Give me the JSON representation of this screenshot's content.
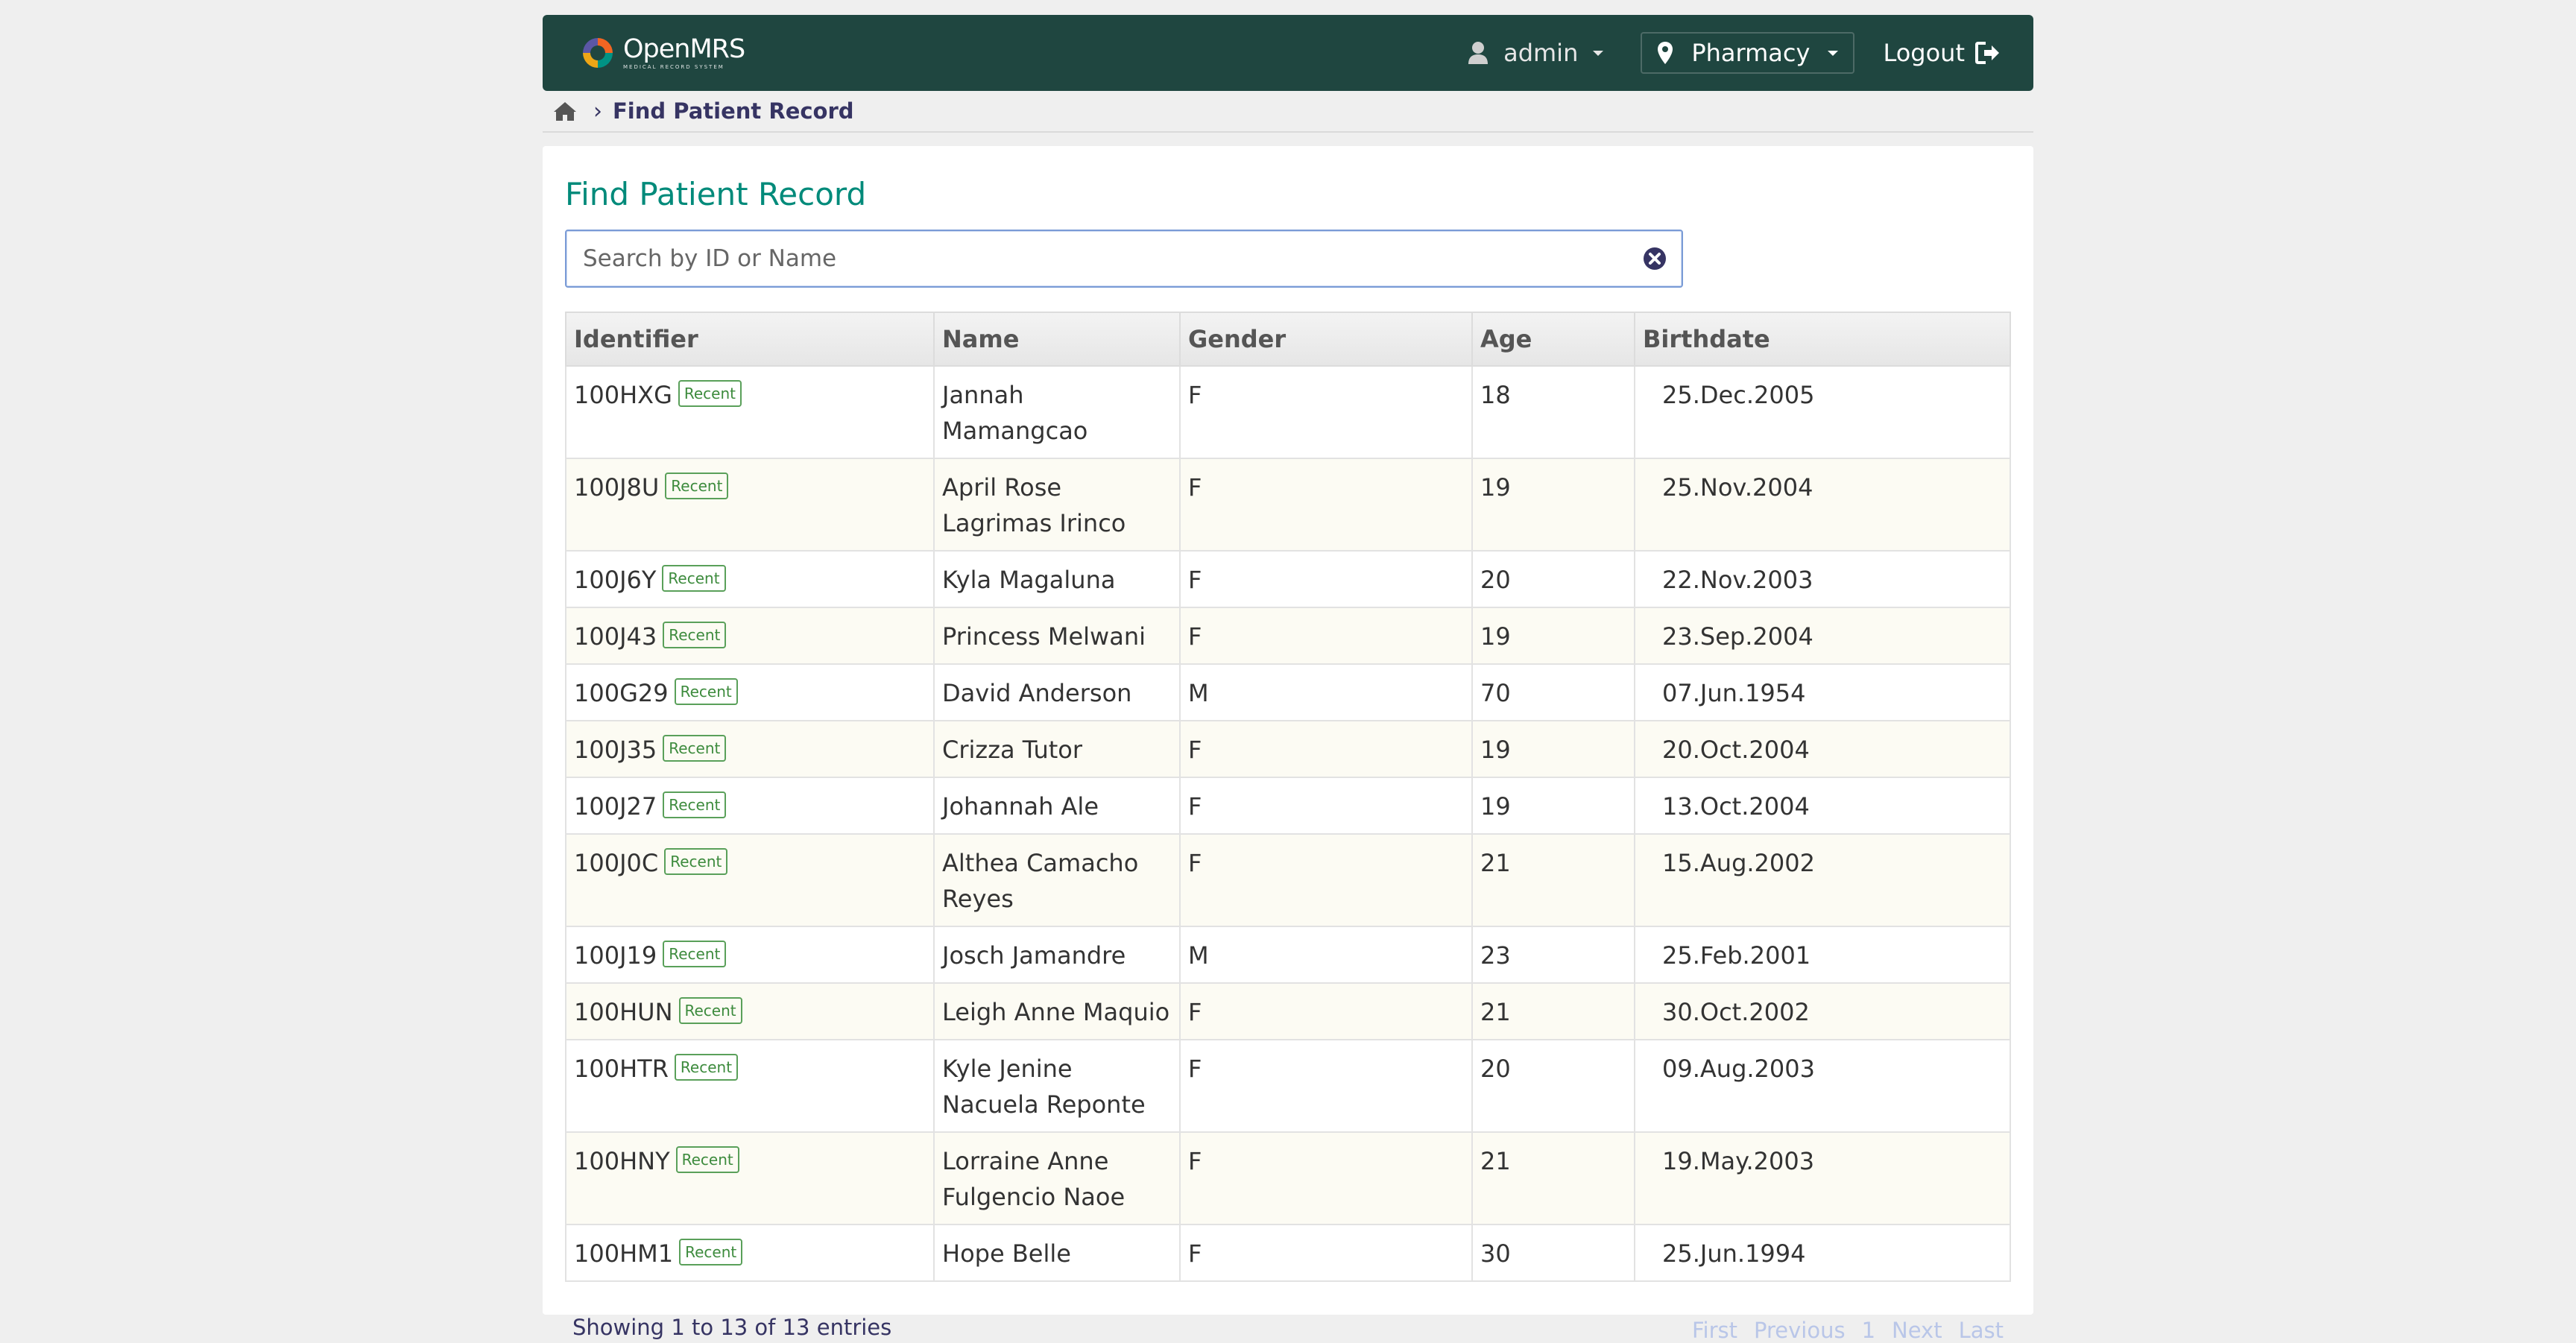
{
  "brand": {
    "name": "OpenMRS",
    "sub": "MEDICAL RECORD SYSTEM"
  },
  "header": {
    "user": "admin",
    "location": "Pharmacy",
    "logout": "Logout"
  },
  "breadcrumb": {
    "current": "Find Patient Record"
  },
  "page": {
    "title": "Find Patient Record"
  },
  "search": {
    "placeholder": "Search by ID or Name"
  },
  "table": {
    "columns": [
      "Identifier",
      "Name",
      "Gender",
      "Age",
      "Birthdate"
    ],
    "badge": "Recent",
    "rows": [
      {
        "id": "100HXG",
        "name": "Jannah Mamangcao",
        "gender": "F",
        "age": "18",
        "birthdate": "25.Dec.2005"
      },
      {
        "id": "100J8U",
        "name": "April Rose Lagrimas Irinco",
        "gender": "F",
        "age": "19",
        "birthdate": "25.Nov.2004"
      },
      {
        "id": "100J6Y",
        "name": "Kyla Magaluna",
        "gender": "F",
        "age": "20",
        "birthdate": "22.Nov.2003"
      },
      {
        "id": "100J43",
        "name": "Princess Melwani",
        "gender": "F",
        "age": "19",
        "birthdate": "23.Sep.2004"
      },
      {
        "id": "100G29",
        "name": "David Anderson",
        "gender": "M",
        "age": "70",
        "birthdate": "07.Jun.1954"
      },
      {
        "id": "100J35",
        "name": "Crizza Tutor",
        "gender": "F",
        "age": "19",
        "birthdate": "20.Oct.2004"
      },
      {
        "id": "100J27",
        "name": "Johannah Ale",
        "gender": "F",
        "age": "19",
        "birthdate": "13.Oct.2004"
      },
      {
        "id": "100J0C",
        "name": "Althea Camacho Reyes",
        "gender": "F",
        "age": "21",
        "birthdate": "15.Aug.2002"
      },
      {
        "id": "100J19",
        "name": "Josch Jamandre",
        "gender": "M",
        "age": "23",
        "birthdate": "25.Feb.2001"
      },
      {
        "id": "100HUN",
        "name": "Leigh Anne Maquio",
        "gender": "F",
        "age": "21",
        "birthdate": "30.Oct.2002"
      },
      {
        "id": "100HTR",
        "name": "Kyle Jenine Nacuela Reponte",
        "gender": "F",
        "age": "20",
        "birthdate": "09.Aug.2003"
      },
      {
        "id": "100HNY",
        "name": "Lorraine Anne Fulgencio Naoe",
        "gender": "F",
        "age": "21",
        "birthdate": "19.May.2003"
      },
      {
        "id": "100HM1",
        "name": "Hope Belle",
        "gender": "F",
        "age": "30",
        "birthdate": "25.Jun.1994"
      }
    ]
  },
  "footer": {
    "info": "Showing 1 to 13 of 13 entries",
    "pager": {
      "first": "First",
      "previous": "Previous",
      "page": "1",
      "next": "Next",
      "last": "Last"
    }
  }
}
